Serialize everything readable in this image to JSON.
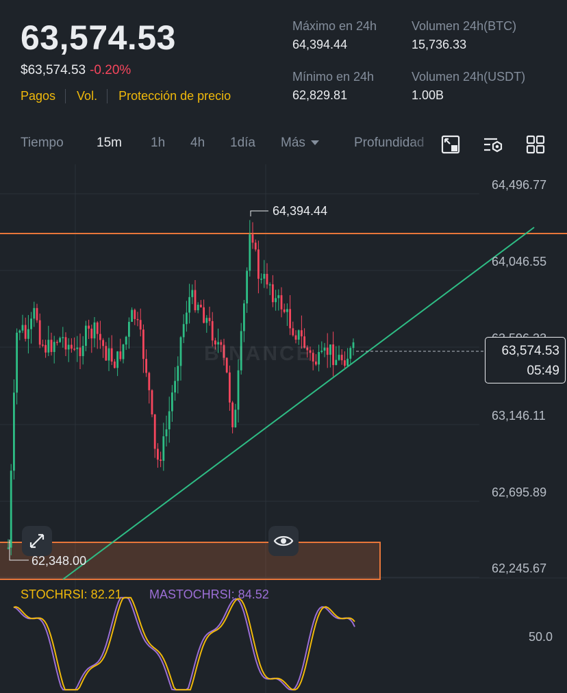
{
  "header": {
    "last_price": "63,574.53",
    "usd_price": "$63,574.53",
    "change_pct": "-0.20%",
    "links": [
      "Pagos",
      "Vol.",
      "Protección de precio"
    ],
    "high_label": "Máximo en 24h",
    "high_value": "64,394.44",
    "vol_btc_label": "Volumen 24h(BTC)",
    "vol_btc_value": "15,736.33",
    "low_label": "Mínimo en 24h",
    "low_value": "62,829.81",
    "vol_usdt_label": "Volumen 24h(USDT)",
    "vol_usdt_value": "1.00B"
  },
  "tabs": {
    "time": "Tiempo",
    "m15": "15m",
    "h1": "1h",
    "h4": "4h",
    "d1": "1día",
    "more": "Más",
    "depth": "Profundidad"
  },
  "chart": {
    "price_axis": [
      "64,496.77",
      "64,046.55",
      "63,596.33",
      "63,146.11",
      "62,695.89",
      "62,245.67"
    ],
    "current_price": "63,574.53",
    "countdown": "05:49",
    "high_marker": "64,394.44",
    "low_marker": "62,348.00",
    "watermark": "BINANCE",
    "colors": {
      "up": "#2ebd85",
      "down": "#f6465d",
      "trend": "#2ebd85",
      "resistance": "#e8763a",
      "zone": "#e8763a"
    }
  },
  "indicator": {
    "stoch_label": "STOCHRSI: 82.21",
    "ma_label": "MASTOCHRSI: 84.52",
    "axis_label": "50.0",
    "colors": {
      "stoch": "#f0b90b",
      "ma": "#9c6fd6"
    }
  },
  "icons": [
    "fullscreen-toggle-icon",
    "indicator-settings-icon",
    "grid-layout-icon",
    "expand-icon",
    "eye-icon"
  ]
}
